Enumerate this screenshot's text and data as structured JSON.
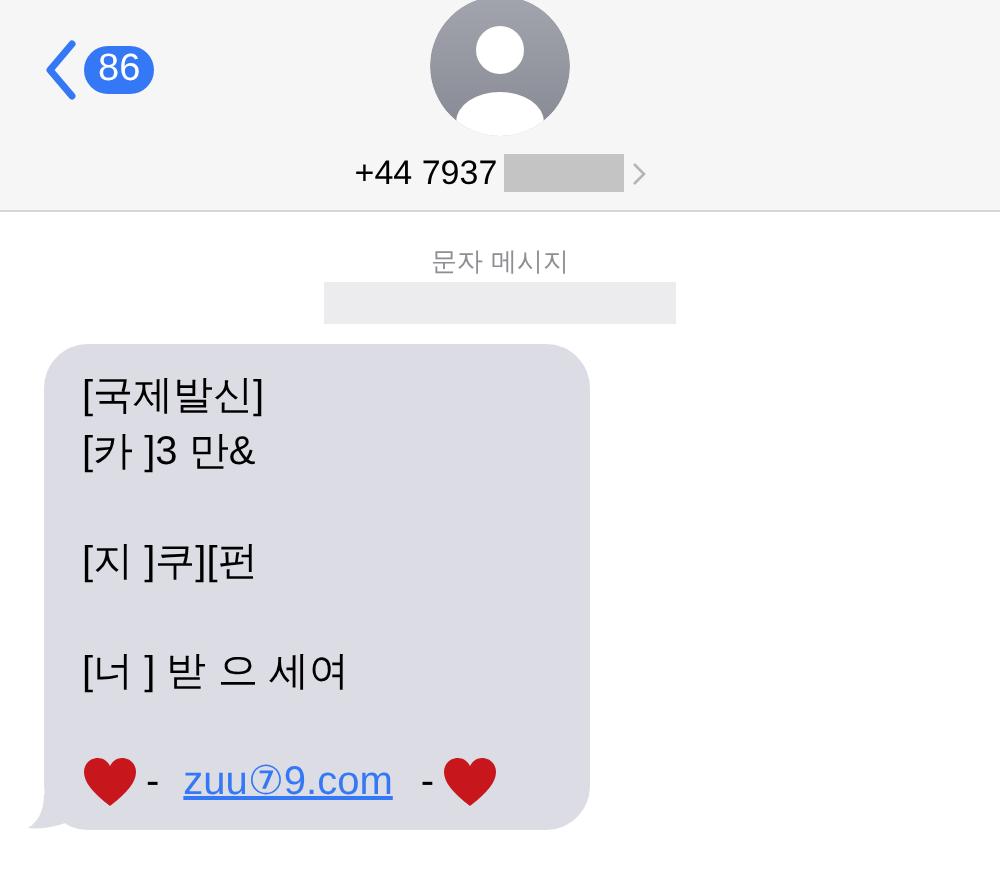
{
  "header": {
    "back_badge": "86",
    "contact": "+44 7937"
  },
  "conversation": {
    "label": "문자 메시지"
  },
  "message": {
    "paragraphs": [
      "[국제발신]\n[카 ]3 만&",
      "[지 ]쿠][펀",
      "[너 ] 받 으 세여"
    ],
    "link_line": {
      "before": "-",
      "link": "zuu⑦9.com",
      "after": "-"
    }
  }
}
